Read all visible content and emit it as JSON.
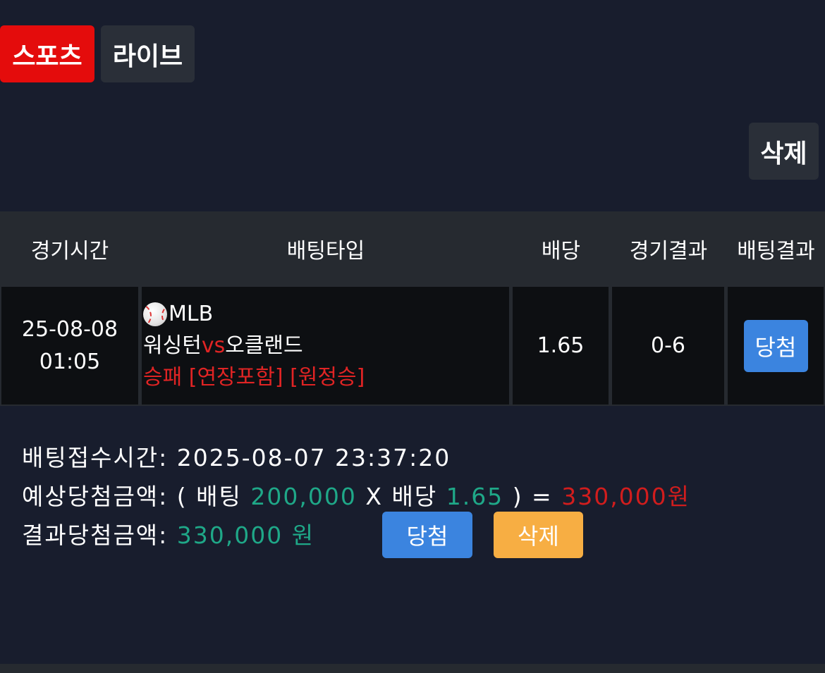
{
  "tabs": [
    {
      "label": "스포츠",
      "active": true
    },
    {
      "label": "라이브",
      "active": false
    }
  ],
  "toolbar": {
    "delete_label": "삭제"
  },
  "table": {
    "headers": [
      "경기시간",
      "배팅타입",
      "배당",
      "경기결과",
      "배팅결과"
    ],
    "row": {
      "date": "25-08-08",
      "time": "01:05",
      "sport_icon": "baseball-icon",
      "league": "MLB",
      "home_team": "워싱턴",
      "vs_label": "vs",
      "away_team": "오클랜드",
      "market": "승패 [연장포함] [원정승]",
      "odds": "1.65",
      "score": "0-6",
      "bet_result": "당첨"
    }
  },
  "summary": {
    "received_label": "배팅접수시간:",
    "received_time": "2025-08-07 23:37:20",
    "expected_label": "예상당첨금액:",
    "open_paren": "(",
    "bet_word": "배팅",
    "stake": "200,000",
    "times": "X",
    "odds_word": "배당",
    "odds": "1.65",
    "close_eq": ") =",
    "expected_amount": "330,000원",
    "result_label": "결과당첨금액:",
    "result_amount": "330,000 원"
  },
  "actions": {
    "win_label": "당첨",
    "delete_label": "삭제"
  },
  "colors": {
    "background": "#181d2d",
    "accent_red": "#e40c0c",
    "win_blue": "#3b84df",
    "delete_orange": "#f7ae43",
    "amount_green": "#1fa888",
    "amount_red": "#d11d1d"
  }
}
